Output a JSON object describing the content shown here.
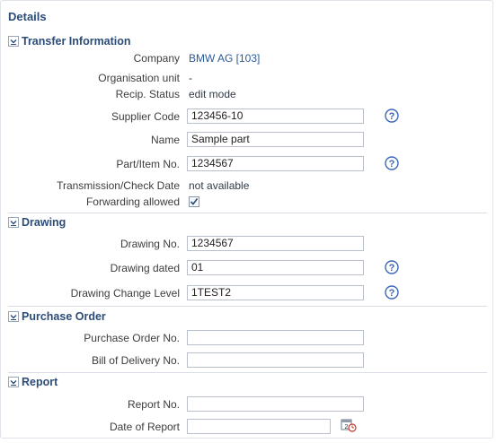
{
  "panel": {
    "title": "Details"
  },
  "transfer": {
    "heading": "Transfer Information",
    "company_label": "Company",
    "company_value": "BMW AG [103]",
    "org_label": "Organisation unit",
    "org_value": "-",
    "recip_label": "Recip. Status",
    "recip_value": "edit mode",
    "supplier_label": "Supplier Code",
    "supplier_value": "123456-10",
    "name_label": "Name",
    "name_value": "Sample part",
    "part_label": "Part/Item No.",
    "part_value": "1234567",
    "transmission_label": "Transmission/Check Date",
    "transmission_value": "not available",
    "forwarding_label": "Forwarding allowed",
    "forwarding_checked": true
  },
  "drawing": {
    "heading": "Drawing",
    "no_label": "Drawing No.",
    "no_value": "1234567",
    "dated_label": "Drawing dated",
    "dated_value": "01",
    "change_label": "Drawing Change Level",
    "change_value": "1TEST2"
  },
  "purchase": {
    "heading": "Purchase Order",
    "po_label": "Purchase Order No.",
    "po_value": "",
    "bod_label": "Bill of Delivery No.",
    "bod_value": ""
  },
  "report": {
    "heading": "Report",
    "no_label": "Report No.",
    "no_value": "",
    "date_label": "Date of Report",
    "date_value": ""
  },
  "colors": {
    "heading": "#2b4c78",
    "link": "#2a5a9a",
    "help": "#3b67b5"
  },
  "icons": [
    "collapse-chevron-icon",
    "help-icon",
    "calendar-icon",
    "checkmark-icon"
  ]
}
